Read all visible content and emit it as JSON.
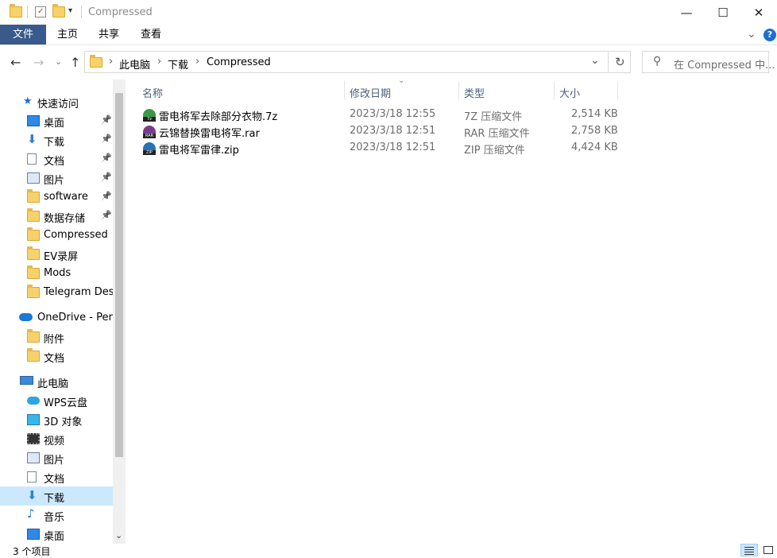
{
  "window": {
    "title": "Compressed",
    "minimize_glyph": "—",
    "maximize_glyph": "☐",
    "close_glyph": "✕"
  },
  "ribbon": {
    "tabs": [
      "文件",
      "主页",
      "共享",
      "查看"
    ],
    "expand_glyph": "⌄",
    "help_glyph": "?"
  },
  "nav": {
    "back_glyph": "←",
    "forward_glyph": "→",
    "recent_glyph": "⌄",
    "up_glyph": "↑",
    "breadcrumb": [
      "此电脑",
      "下载",
      "Compressed"
    ],
    "crumb_sep": "›",
    "dropdown_glyph": "⌄",
    "refresh_glyph": "↻",
    "search_placeholder": "在 Compressed 中...",
    "search_glyph": "⚲"
  },
  "sidebar": {
    "quick_access": "快速访问",
    "quick_items": [
      {
        "label": "桌面",
        "pinned": true,
        "icon": "desktop-icon"
      },
      {
        "label": "下载",
        "pinned": true,
        "icon": "download-icon"
      },
      {
        "label": "文档",
        "pinned": true,
        "icon": "document-icon"
      },
      {
        "label": "图片",
        "pinned": true,
        "icon": "picture-icon"
      },
      {
        "label": "software",
        "pinned": true,
        "icon": "folder-icon"
      },
      {
        "label": "数据存储",
        "pinned": true,
        "icon": "folder-icon"
      },
      {
        "label": "Compressed",
        "pinned": false,
        "icon": "folder-icon"
      },
      {
        "label": "EV录屏",
        "pinned": false,
        "icon": "folder-icon"
      },
      {
        "label": "Mods",
        "pinned": false,
        "icon": "folder-icon"
      },
      {
        "label": "Telegram Desk",
        "pinned": false,
        "icon": "folder-icon"
      }
    ],
    "onedrive": "OneDrive - Perso",
    "onedrive_items": [
      {
        "label": "附件",
        "icon": "folder-icon"
      },
      {
        "label": "文档",
        "icon": "folder-icon"
      }
    ],
    "thispc": "此电脑",
    "pc_items": [
      {
        "label": "WPS云盘",
        "icon": "cloud-icon"
      },
      {
        "label": "3D 对象",
        "icon": "3d-objects-icon"
      },
      {
        "label": "视频",
        "icon": "video-icon"
      },
      {
        "label": "图片",
        "icon": "picture-icon"
      },
      {
        "label": "文档",
        "icon": "document-icon"
      },
      {
        "label": "下载",
        "icon": "download-icon",
        "selected": true
      },
      {
        "label": "音乐",
        "icon": "music-icon"
      },
      {
        "label": "桌面",
        "icon": "desktop-icon"
      }
    ],
    "pin_glyph": "📌",
    "scroll_down_glyph": "⌄"
  },
  "columns": {
    "name": "名称",
    "date": "修改日期",
    "type": "类型",
    "size": "大小",
    "sort_glyph": "⌄"
  },
  "files": [
    {
      "name": "雷电将军去除部分衣物.7z",
      "date": "2023/3/18 12:55",
      "type": "7Z 压缩文件",
      "size": "2,514 KB",
      "icon": "7z-archive-icon",
      "icon_color": "#3a9a4a",
      "badge": "7z"
    },
    {
      "name": "云锦替换雷电将军.rar",
      "date": "2023/3/18 12:51",
      "type": "RAR 压缩文件",
      "size": "2,758 KB",
      "icon": "rar-archive-icon",
      "icon_color": "#7a3b8f",
      "badge": "RAR"
    },
    {
      "name": "雷电将军雷律.zip",
      "date": "2023/3/18 12:51",
      "type": "ZIP 压缩文件",
      "size": "4,424 KB",
      "icon": "zip-archive-icon",
      "icon_color": "#2a72b8",
      "badge": "ZIP"
    }
  ],
  "status": {
    "count": "3 个项目"
  }
}
